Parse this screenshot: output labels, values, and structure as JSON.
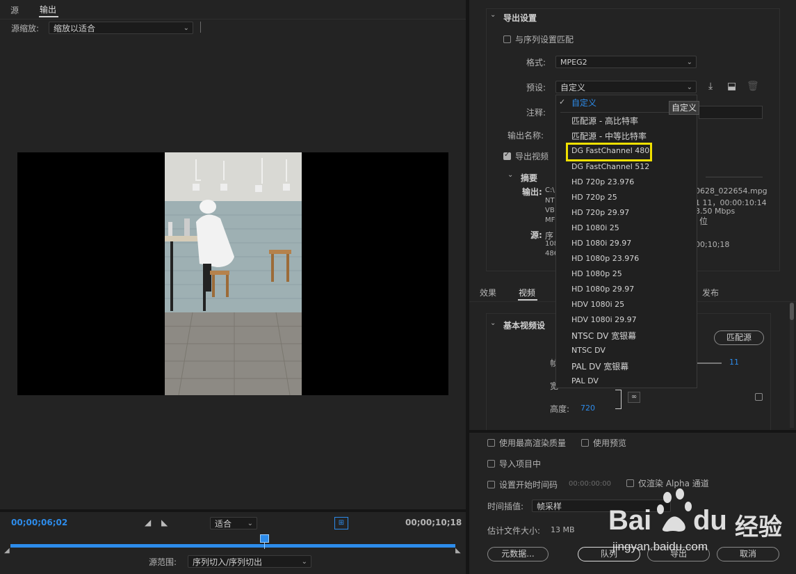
{
  "tabs": {
    "source": "源",
    "output": "输出"
  },
  "source_scale": {
    "label": "源缩放:",
    "value": "缩放以适合"
  },
  "timeline": {
    "current_time": "00;00;06;02",
    "end_time": "00;00;10;18",
    "fit_value": "适合",
    "progress": 0.57,
    "source_range_label": "源范围:",
    "source_range_value": "序列切入/序列切出"
  },
  "export_settings": {
    "title": "导出设置",
    "match_sequence_label": "与序列设置匹配",
    "format_label": "格式:",
    "format_value": "MPEG2",
    "preset_label": "预设:",
    "preset_value": "自定义",
    "comment_label": "注释:",
    "output_name_label": "输出名称:",
    "export_video_label": "导出视频",
    "tooltip": "自定义"
  },
  "summary": {
    "title": "摘要",
    "output_label": "输出:",
    "output_lines": [
      "C:\\",
      "NT",
      "VB",
      "MF"
    ],
    "output_right": [
      "0628_022654.mpg",
      "1 11，00:00:10:14",
      "3.50 Mbps",
      "位"
    ],
    "source_label": "源:",
    "source_lines": [
      "序",
      "108",
      "486"
    ],
    "source_right": [
      "00;10;18"
    ]
  },
  "preset_menu": {
    "checked": "自定义",
    "items": [
      "匹配源 - 高比特率",
      "匹配源 - 中等比特率",
      "DG FastChannel 480",
      "DG FastChannel 512",
      "HD 720p 23.976",
      "HD 720p 25",
      "HD 720p 29.97",
      "HD 1080i 25",
      "HD 1080i 29.97",
      "HD 1080p 23.976",
      "HD 1080p 25",
      "HD 1080p 29.97",
      "HDV 1080i 25",
      "HDV 1080i 29.97",
      "NTSC DV 宽银幕",
      "NTSC DV",
      "PAL DV 宽银幕",
      "PAL DV"
    ],
    "highlighted": "DG FastChannel 480"
  },
  "settings_tabs": {
    "effects": "效果",
    "video": "视频",
    "publish": "发布"
  },
  "basic_video": {
    "title": "基本视频设",
    "match_source_btn": "匹配源",
    "width_label": "宽",
    "frame_label": "帧",
    "frame_value": "11",
    "height_label": "高度:",
    "height_value": "720"
  },
  "options": {
    "max_render_quality": "使用最高渲染质量",
    "use_previews": "使用预览",
    "import_into_project": "导入项目中",
    "set_start_timecode": "设置开始时间码",
    "timecode_value": "00:00:00:00",
    "render_alpha_only": "仅渲染 Alpha 通道",
    "time_interp_label": "时间插值:",
    "time_interp_value": "帧采样",
    "est_size_label": "估计文件大小:",
    "est_size_value": "13 MB"
  },
  "buttons": {
    "metadata": "元数据...",
    "queue": "队列",
    "export": "导出",
    "cancel": "取消"
  },
  "watermark": {
    "brand": "Bai",
    "du": "du",
    "suffix": "经验",
    "url": "jingyan.baidu.com"
  },
  "colors": {
    "accent": "#2d8ceb",
    "highlight_box": "#f0e000",
    "bg": "#1e1e1e"
  }
}
